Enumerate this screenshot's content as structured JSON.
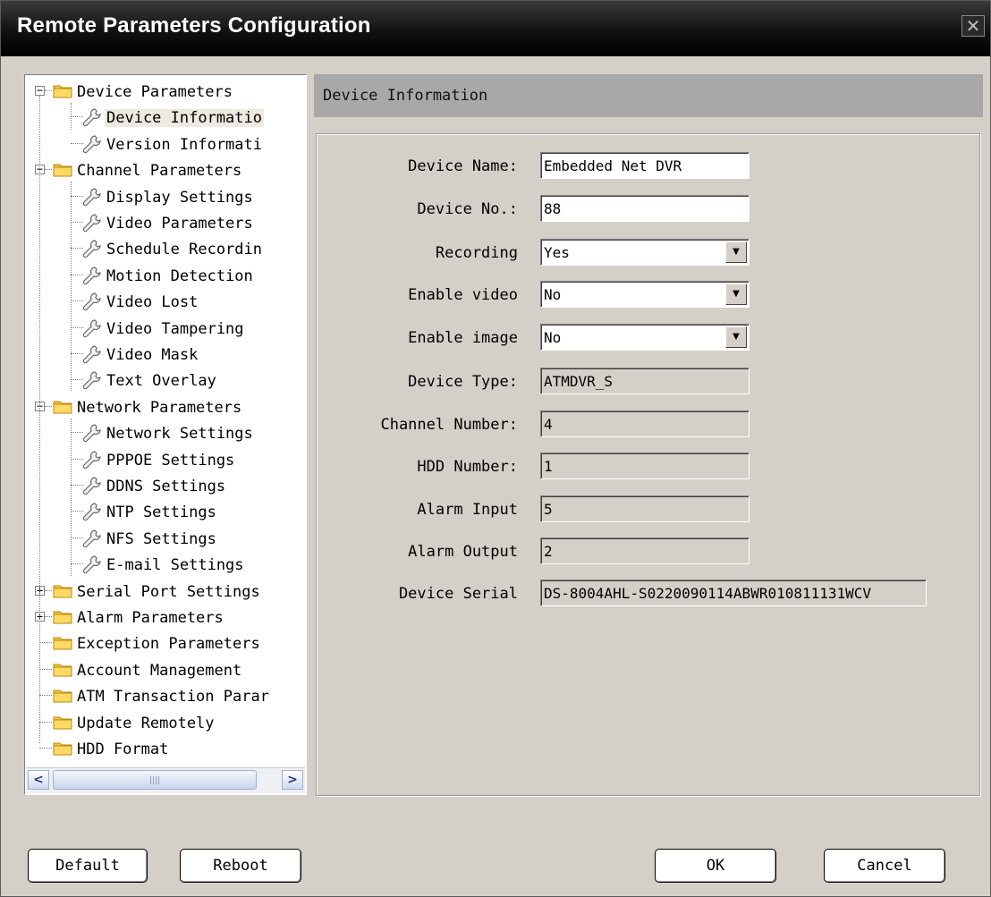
{
  "window": {
    "title": "Remote Parameters Configuration",
    "close_glyph": "✕"
  },
  "tree": {
    "items": [
      {
        "label": "Device Parameters",
        "level": 0,
        "type": "folder",
        "expander": "−"
      },
      {
        "label": "Device Informatio",
        "level": 1,
        "type": "leaf",
        "selected": true
      },
      {
        "label": "Version Informati",
        "level": 1,
        "type": "leaf"
      },
      {
        "label": "Channel Parameters",
        "level": 0,
        "type": "folder",
        "expander": "−"
      },
      {
        "label": "Display Settings",
        "level": 1,
        "type": "leaf"
      },
      {
        "label": "Video Parameters",
        "level": 1,
        "type": "leaf"
      },
      {
        "label": "Schedule Recordin",
        "level": 1,
        "type": "leaf"
      },
      {
        "label": "Motion Detection",
        "level": 1,
        "type": "leaf"
      },
      {
        "label": "Video Lost",
        "level": 1,
        "type": "leaf"
      },
      {
        "label": "Video Tampering",
        "level": 1,
        "type": "leaf"
      },
      {
        "label": "Video Mask",
        "level": 1,
        "type": "leaf"
      },
      {
        "label": "Text Overlay",
        "level": 1,
        "type": "leaf"
      },
      {
        "label": "Network Parameters",
        "level": 0,
        "type": "folder",
        "expander": "−"
      },
      {
        "label": "Network Settings",
        "level": 1,
        "type": "leaf"
      },
      {
        "label": "PPPOE Settings",
        "level": 1,
        "type": "leaf"
      },
      {
        "label": "DDNS Settings",
        "level": 1,
        "type": "leaf"
      },
      {
        "label": "NTP Settings",
        "level": 1,
        "type": "leaf"
      },
      {
        "label": "NFS Settings",
        "level": 1,
        "type": "leaf"
      },
      {
        "label": "E-mail Settings",
        "level": 1,
        "type": "leaf"
      },
      {
        "label": "Serial Port Settings",
        "level": 0,
        "type": "folder",
        "expander": "+"
      },
      {
        "label": "Alarm Parameters",
        "level": 0,
        "type": "folder",
        "expander": "+"
      },
      {
        "label": "Exception Parameters",
        "level": 0,
        "type": "folder"
      },
      {
        "label": "Account Management",
        "level": 0,
        "type": "folder"
      },
      {
        "label": "ATM Transaction Parar",
        "level": 0,
        "type": "folder"
      },
      {
        "label": "Update Remotely",
        "level": 0,
        "type": "folder"
      },
      {
        "label": "HDD Format",
        "level": 0,
        "type": "folder"
      }
    ],
    "scroll_left": "<",
    "scroll_right": ">"
  },
  "section": {
    "header": "Device Information"
  },
  "form": {
    "fields": [
      {
        "name": "device-name",
        "label": "Device Name:",
        "value": "Embedded Net DVR",
        "kind": "editable"
      },
      {
        "name": "device-no",
        "label": "Device No.:",
        "value": "88",
        "kind": "editable"
      },
      {
        "name": "recording",
        "label": "Recording",
        "value": "Yes",
        "kind": "select"
      },
      {
        "name": "enable-video",
        "label": "Enable video",
        "value": "No",
        "kind": "select"
      },
      {
        "name": "enable-image",
        "label": "Enable image",
        "value": "No",
        "kind": "select"
      },
      {
        "name": "device-type",
        "label": "Device Type:",
        "value": "ATMDVR_S",
        "kind": "readonly"
      },
      {
        "name": "channel-number",
        "label": "Channel Number:",
        "value": "4",
        "kind": "readonly"
      },
      {
        "name": "hdd-number",
        "label": "HDD Number:",
        "value": "1",
        "kind": "readonly"
      },
      {
        "name": "alarm-input",
        "label": "Alarm Input",
        "value": "5",
        "kind": "readonly"
      },
      {
        "name": "alarm-output",
        "label": "Alarm Output",
        "value": "2",
        "kind": "readonly"
      },
      {
        "name": "device-serial",
        "label": "Device Serial",
        "value": "DS-8004AHL-S0220090114ABWR010811131WCV",
        "kind": "readonly"
      }
    ],
    "select_arrow": "▼"
  },
  "buttons": {
    "default": "Default",
    "reboot": "Reboot",
    "ok": "OK",
    "cancel": "Cancel"
  }
}
